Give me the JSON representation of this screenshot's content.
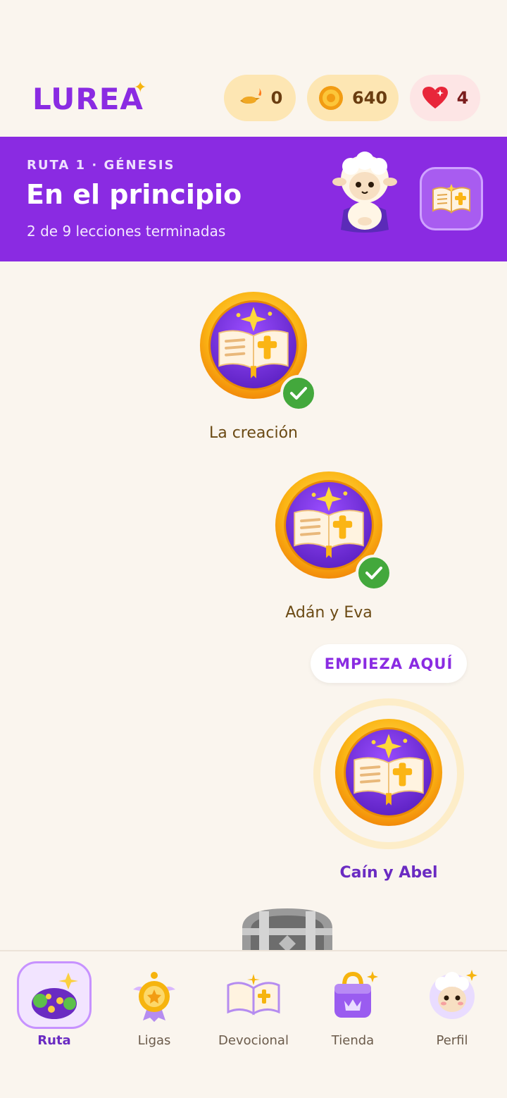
{
  "header": {
    "logo": "LUREA",
    "lamp_count": "0",
    "coin_count": "640",
    "heart_count": "4"
  },
  "banner": {
    "eyebrow": "RUTA 1 · GÉNESIS",
    "title": "En el principio",
    "progress": "2 de 9 lecciones terminadas"
  },
  "path": {
    "start_label": "EMPIEZA AQUÍ",
    "lessons": [
      {
        "label": "La creación",
        "status": "completed"
      },
      {
        "label": "Adán y Eva",
        "status": "completed"
      },
      {
        "label": "Caín y Abel",
        "status": "current"
      }
    ]
  },
  "nav": {
    "items": [
      {
        "label": "Ruta"
      },
      {
        "label": "Ligas"
      },
      {
        "label": "Devocional"
      },
      {
        "label": "Tienda"
      },
      {
        "label": "Perfil"
      }
    ]
  },
  "colors": {
    "brand": "#8a2be2",
    "background": "#faf5ee",
    "gold": "#f6b40e",
    "check": "#43a83c"
  }
}
